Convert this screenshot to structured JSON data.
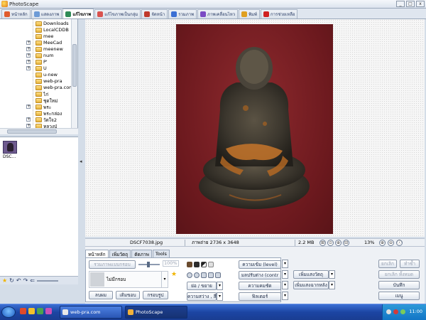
{
  "window": {
    "title": "PhotoScape",
    "min": "_",
    "max": "□",
    "close": "x"
  },
  "main_tabs": [
    {
      "label": "หน้าหลัก",
      "color": "#e05b2c"
    },
    {
      "label": "แสดงภาพ",
      "color": "#6d9bd6"
    },
    {
      "label": "แก้ไขภาพ",
      "color": "#2e8b57"
    },
    {
      "label": "แก้ไขภาพเป็นกลุ่ม",
      "color": "#d9534f"
    },
    {
      "label": "จัดหน้า",
      "color": "#c0392b"
    },
    {
      "label": "รวมภาพ",
      "color": "#3b6fd4"
    },
    {
      "label": "ภาพเคลื่อนไหว",
      "color": "#7b4bc4"
    },
    {
      "label": "พิมพ์",
      "color": "#e0a020"
    },
    {
      "label": "การช่วยเหลือ",
      "color": "#d02020"
    }
  ],
  "folder_tree": [
    {
      "label": "Downloads",
      "expander": ""
    },
    {
      "label": "LocalCDDB",
      "expander": ""
    },
    {
      "label": "mee",
      "expander": ""
    },
    {
      "label": "MeeCad",
      "expander": "+"
    },
    {
      "label": "meenew",
      "expander": "+"
    },
    {
      "label": "num",
      "expander": "+"
    },
    {
      "label": "P'",
      "expander": "+"
    },
    {
      "label": "U",
      "expander": "+"
    },
    {
      "label": "u-new",
      "expander": ""
    },
    {
      "label": "web-pra",
      "expander": ""
    },
    {
      "label": "web-pra.com",
      "expander": ""
    },
    {
      "label": "ไก่",
      "expander": ""
    },
    {
      "label": "ชุดใหม่",
      "expander": ""
    },
    {
      "label": "พระ",
      "expander": "+"
    },
    {
      "label": "พระกล่อง",
      "expander": ""
    },
    {
      "label": "วัดใจ2",
      "expander": "+"
    },
    {
      "label": "หลวงปู่",
      "expander": "+"
    }
  ],
  "thumbnail": {
    "name": "DSC..."
  },
  "splitter_arrow": "◂",
  "left_toolbar": {
    "star": "★",
    "add": "↻",
    "undo": "↶",
    "redo": "↷",
    "back": "⇐"
  },
  "status": {
    "filename": "DSCF7038.jpg",
    "dimensions": "ภาพถ่าย 2736 x 3648",
    "filesize": "2.2 MB",
    "zoom": "13%"
  },
  "editor": {
    "tabs": [
      "หน้าหลัก",
      "เพิ่มวัตถุ",
      "ตัดภาพ",
      "Tools"
    ],
    "merge_btn": "รวมภาพแบบกรอบ",
    "opacity": "100%",
    "frame_label": "ไม่มีกรอบ",
    "frame_dd": "▾",
    "star": "★",
    "btn_remove": "ลบผม",
    "btn_shadow": "เติมขอบ",
    "btn_frame": "กรอบรูป",
    "resize": "ย่อ / ขยาย",
    "brightness": "ความสว่าง , สี",
    "level": "ความเข้ม (level)",
    "contrast": "มลปรับต่าง (contr",
    "sharpen": "ความคมชัด",
    "filter": "ฟิลเตอร์",
    "backlight": "เพิ่มแสงวัตถุ",
    "bg_light": "เพิ่มแสงฉากหลัง",
    "undo": "ยกเลิก",
    "redo": "ทำซ้ำ",
    "undo_all": "ยกเลิก ทั้งหมด",
    "save": "บันทึก",
    "menu": "เมนู"
  },
  "zoom_icons": [
    "⊞",
    "⊙",
    "⊕",
    "⊟"
  ],
  "zoom_icons2": [
    "⊕",
    "⊖",
    "ⓘ"
  ],
  "taskbar": {
    "items": [
      {
        "label": "web-pra.com",
        "active": false
      },
      {
        "label": "PhotoScape",
        "active": true
      }
    ],
    "clock": "11:00"
  }
}
